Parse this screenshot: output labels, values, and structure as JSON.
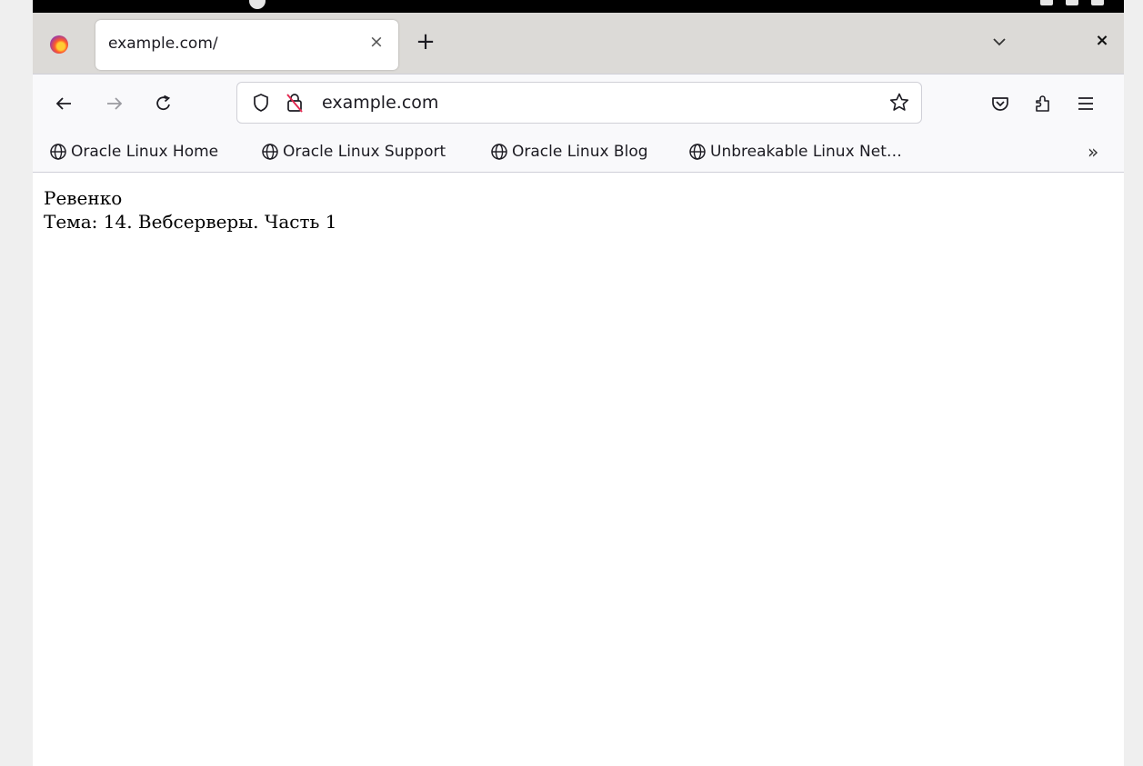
{
  "tab": {
    "title": "example.com/",
    "close_label": "×",
    "new_tab_label": "+"
  },
  "navbar": {
    "url": "example.com"
  },
  "bookmarks": [
    {
      "label": "Oracle Linux Home"
    },
    {
      "label": "Oracle Linux Support"
    },
    {
      "label": "Oracle Linux Blog"
    },
    {
      "label": "Unbreakable Linux Net…"
    }
  ],
  "bookmarks_overflow": "»",
  "window_close": "×",
  "page": {
    "line1": "Ревенко",
    "line2": "Тема: 14. Вебсерверы. Часть 1"
  }
}
